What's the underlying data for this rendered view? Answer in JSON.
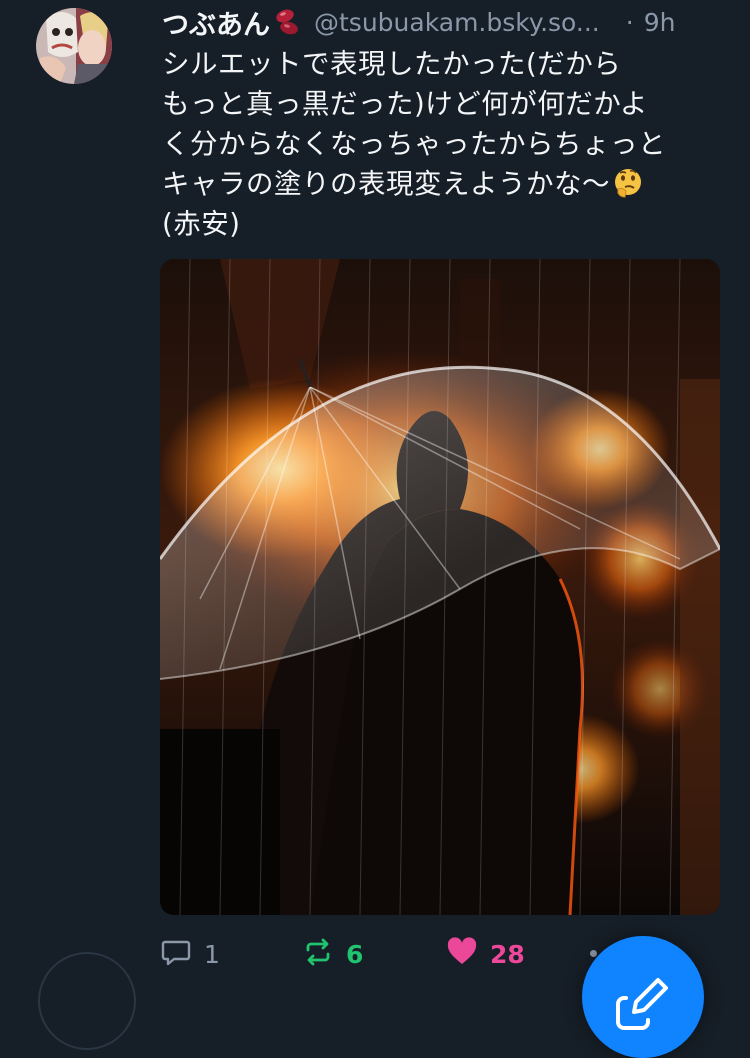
{
  "post": {
    "display_name": "つぶあん",
    "handle": "@tsubuakam.bsky.so...",
    "separator": "·",
    "timestamp": "9h",
    "text": "シルエットで表現したかった(だから\nもっと真っ黒だった)けど何が何だかよ\nく分からなくなっちゃったからちょっと\nキャラの塗りの表現変えようかな～",
    "text_tail": "(赤安)",
    "icons": {
      "name_emoji": "beans-emoji-icon",
      "text_emoji": "thinking-face-emoji-icon",
      "reply": "reply-icon",
      "repost": "repost-icon",
      "like": "heart-icon",
      "compose": "compose-icon"
    },
    "counts": {
      "replies": "1",
      "reposts": "6",
      "likes": "28"
    }
  },
  "colors": {
    "background": "#161e27",
    "muted_text": "#8b98a9",
    "repost_active": "#20c46f",
    "like_active": "#ec4899",
    "fab": "#1083fe"
  }
}
